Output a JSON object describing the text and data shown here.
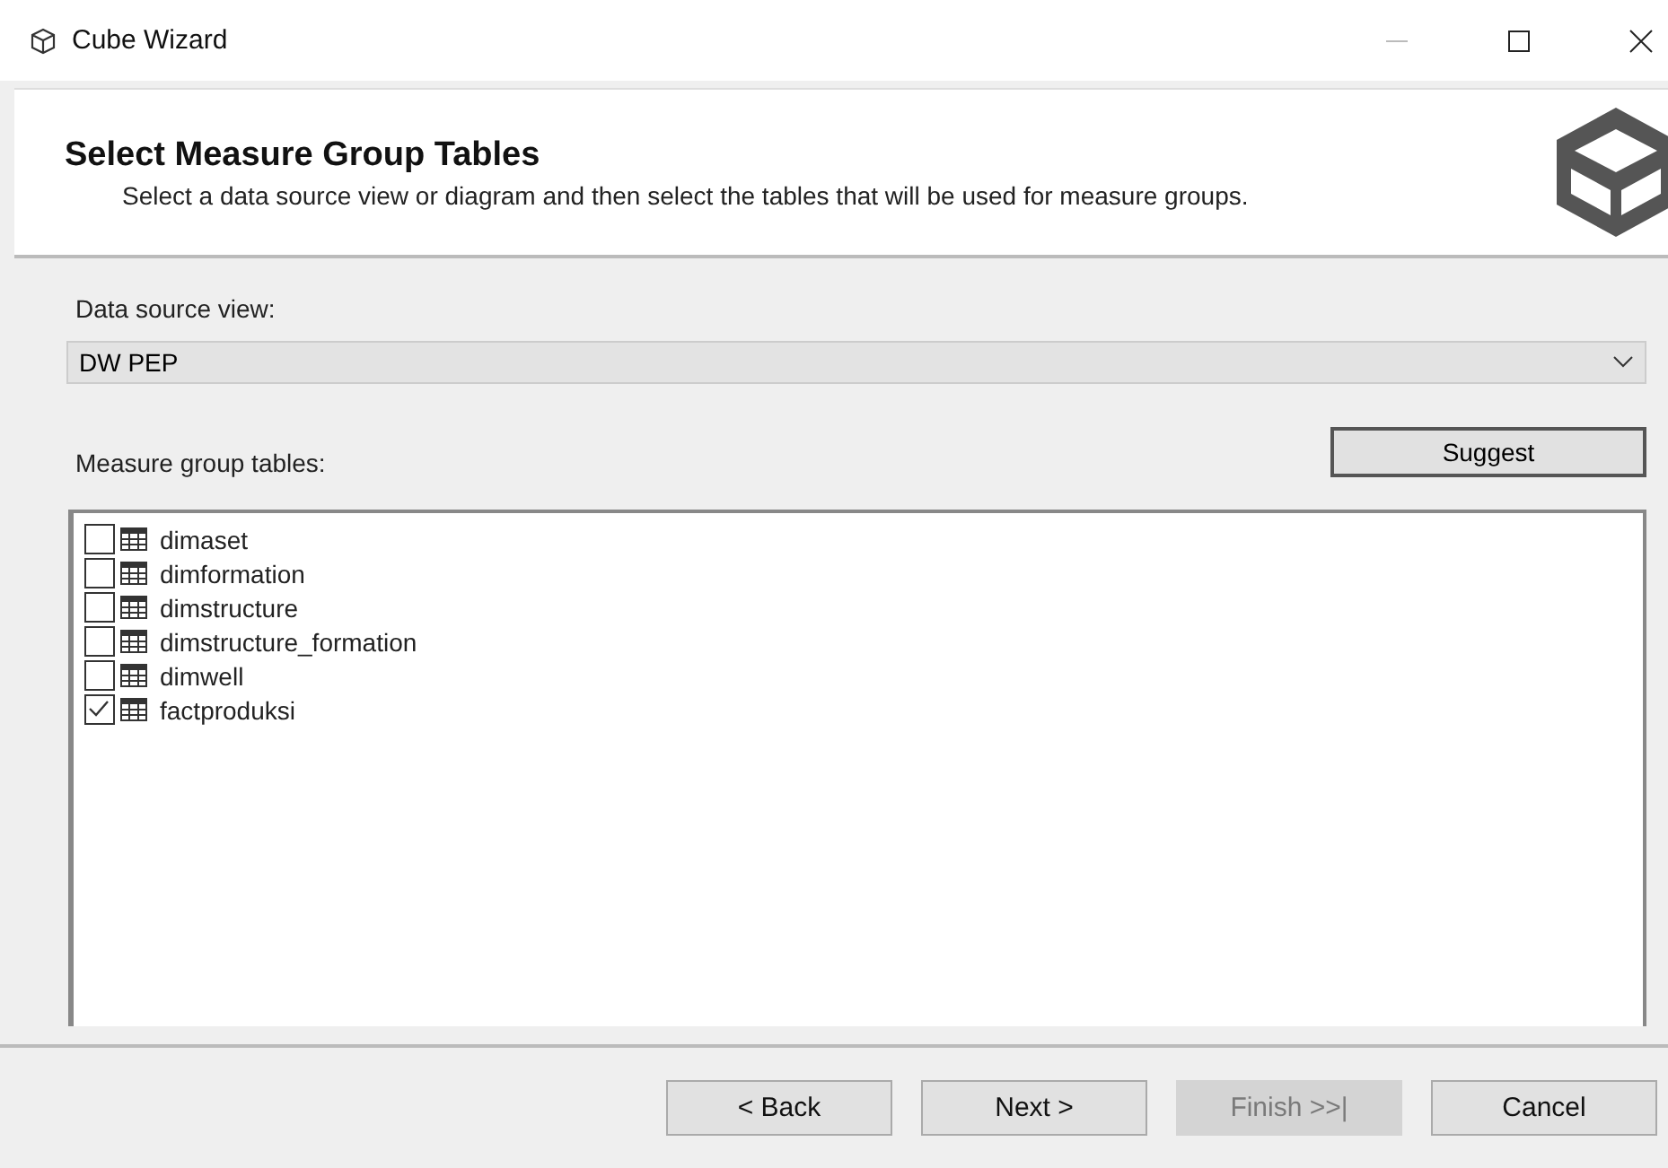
{
  "window": {
    "title": "Cube Wizard"
  },
  "header": {
    "title": "Select Measure Group Tables",
    "description": "Select a data source view or diagram and then select the tables that will be used for measure groups."
  },
  "data_source_view": {
    "label": "Data source view:",
    "value": "DW PEP"
  },
  "suggest_button": "Suggest",
  "tables": {
    "label": "Measure group tables:",
    "items": [
      {
        "name": "dimaset",
        "checked": false
      },
      {
        "name": "dimformation",
        "checked": false
      },
      {
        "name": "dimstructure",
        "checked": false
      },
      {
        "name": "dimstructure_formation",
        "checked": false
      },
      {
        "name": "dimwell",
        "checked": false
      },
      {
        "name": "factproduksi",
        "checked": true
      }
    ]
  },
  "buttons": [
    {
      "label": "< Back",
      "disabled": false
    },
    {
      "label": "Next >",
      "disabled": false
    },
    {
      "label": "Finish >>|",
      "disabled": true
    },
    {
      "label": "Cancel",
      "disabled": false
    }
  ]
}
